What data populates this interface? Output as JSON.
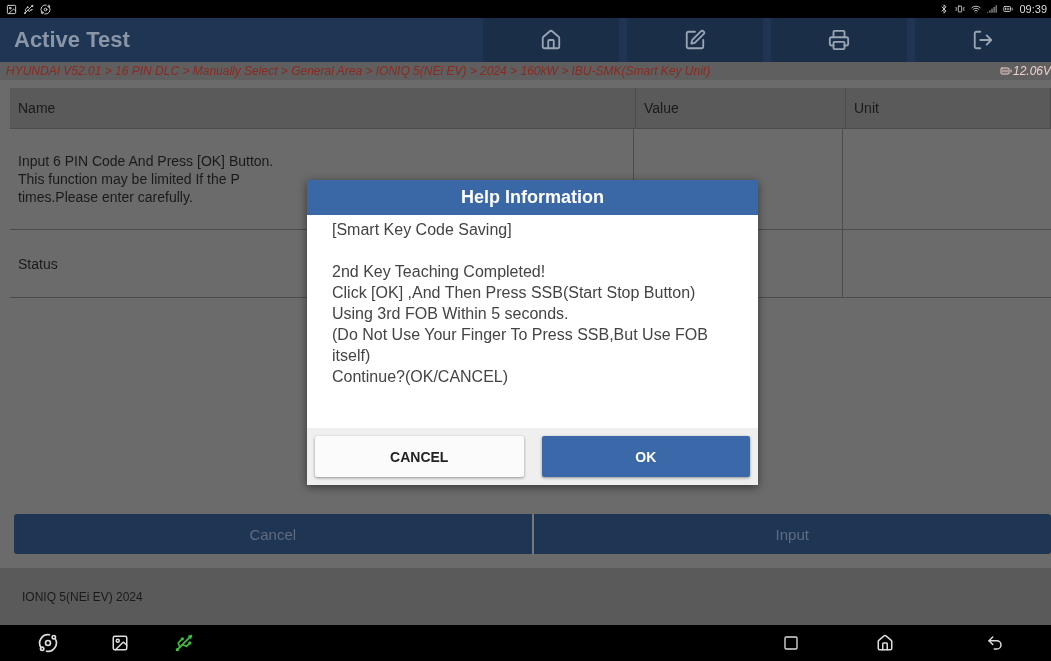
{
  "status_bar": {
    "time": "09:39"
  },
  "header": {
    "title": "Active Test"
  },
  "breadcrumb": {
    "path": "HYUNDAI V52.01 > 16 PIN DLC > Manually Select > General Area > IONIQ 5(NEi EV) > 2024 > 160kW > IBU-SMK(Smart Key Unit)",
    "voltage": "12.06V"
  },
  "table": {
    "columns": [
      "Name",
      "Value",
      "Unit"
    ],
    "rows": [
      {
        "name": "Input 6 PIN Code And Press [OK] Button.\nThis function may be limited If the P\ntimes.Please enter carefully."
      },
      {
        "name": "Status"
      }
    ]
  },
  "actions": [
    "Cancel",
    "Input"
  ],
  "footer": {
    "vehicle": "IONIQ 5(NEi EV) 2024"
  },
  "dialog": {
    "title": "Help Information",
    "message": "[Smart Key Code Saving]\n\n2nd Key Teaching Completed!\nClick [OK] ,And Then Press SSB(Start Stop Button) Using 3rd FOB Within 5 seconds.\n(Do Not Use Your Finger To Press SSB,But Use FOB itself)\nContinue?(OK/CANCEL)",
    "buttons": [
      {
        "label": "CANCEL",
        "kind": "secondary"
      },
      {
        "label": "OK",
        "kind": "primary"
      }
    ]
  }
}
